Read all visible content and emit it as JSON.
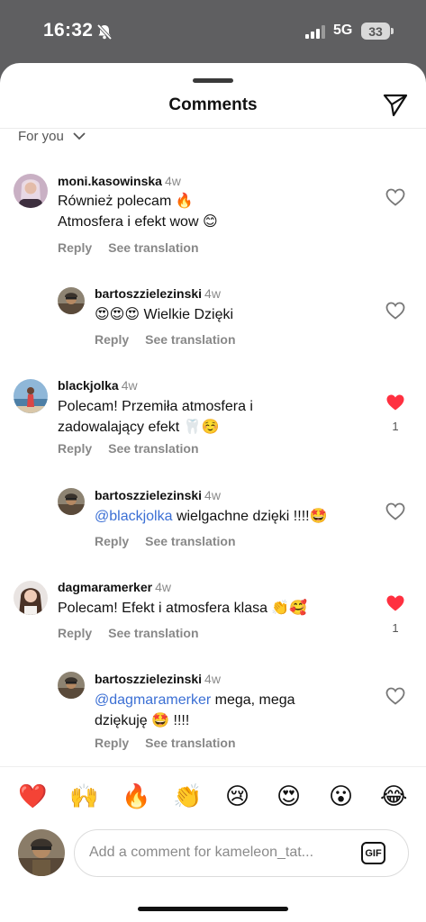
{
  "status": {
    "time": "16:32",
    "network": "5G",
    "battery": "33"
  },
  "header": {
    "title": "Comments"
  },
  "filter": {
    "label": "For you"
  },
  "actions": {
    "reply": "Reply",
    "translate": "See translation"
  },
  "comments": [
    {
      "user": "moni.kasowinska",
      "time": "4w",
      "line1": "Również polecam 🔥",
      "line2": "Atmosfera i efekt wow 😊",
      "liked": false
    },
    {
      "user": "bartoszzielezinski",
      "time": "4w",
      "line1": "😍😍😍 Wielkie Dzięki",
      "liked": false
    },
    {
      "user": "blackjolka",
      "time": "4w",
      "line1": "Polecam! Przemiła atmosfera i",
      "line2": "zadowalający efekt 🦷☺️",
      "liked": true,
      "likes": "1"
    },
    {
      "user": "bartoszzielezinski",
      "time": "4w",
      "mention": "@blackjolka",
      "rest": " wielgachne dzięki !!!!🤩",
      "liked": false
    },
    {
      "user": "dagmaramerker",
      "time": "4w",
      "line1": "Polecam! Efekt i atmosfera klasa 👏🥰",
      "liked": true,
      "likes": "1"
    },
    {
      "user": "bartoszzielezinski",
      "time": "4w",
      "mention": "@dagmaramerker",
      "rest": " mega, mega",
      "line2": "dziękuję 🤩 !!!!",
      "liked": false
    }
  ],
  "quick_reactions": [
    "❤️",
    "🙌",
    "🔥",
    "👏",
    "😢",
    "😍",
    "😮",
    "😂"
  ],
  "composer": {
    "placeholder": "Add a comment for kameleon_tat...",
    "gif": "GIF"
  },
  "colors": {
    "like_red": "#ff3040",
    "mention_blue": "#3b6fd4",
    "muted": "#888888"
  }
}
